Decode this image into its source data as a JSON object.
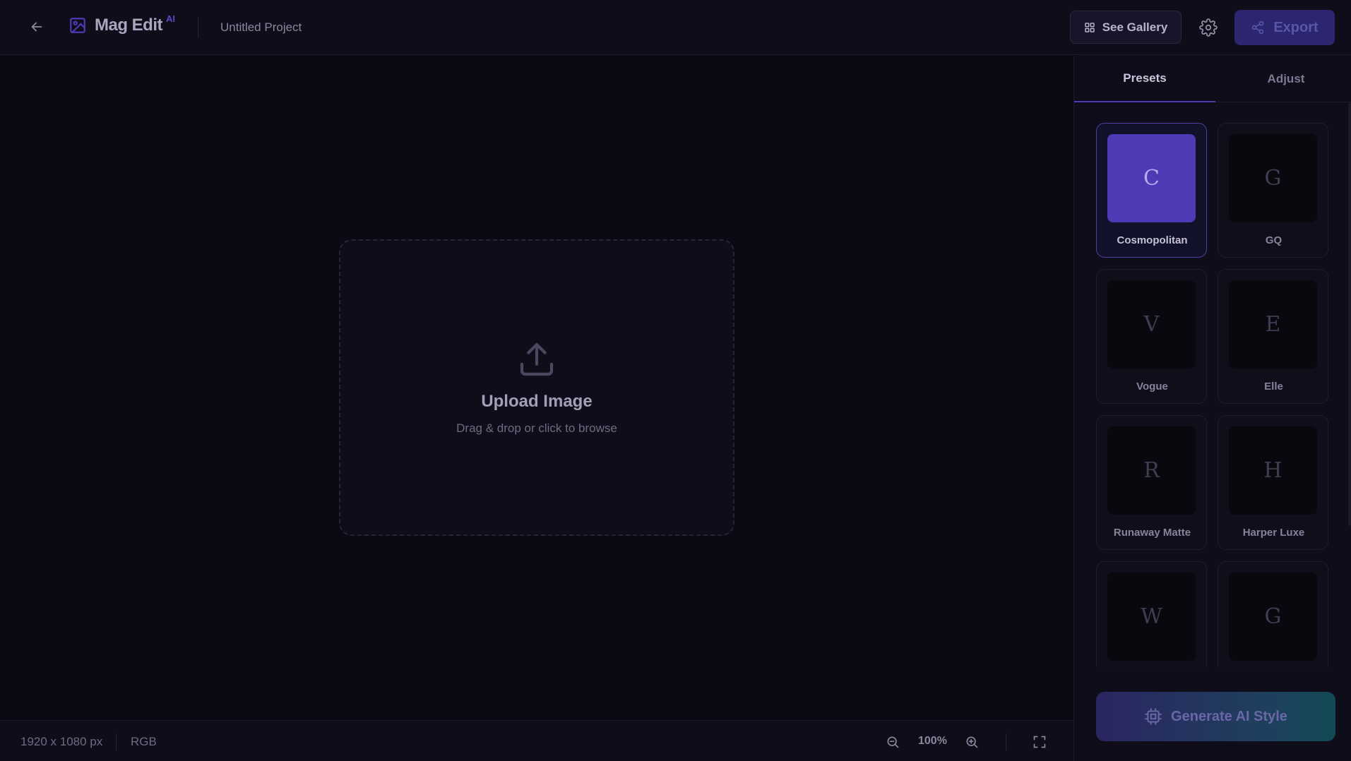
{
  "header": {
    "app_name": "Mag Edit",
    "app_badge": "AI",
    "project_title": "Untitled Project",
    "gallery_label": "See Gallery",
    "export_label": "Export"
  },
  "upload": {
    "title": "Upload Image",
    "subtitle": "Drag & drop or click to browse"
  },
  "status": {
    "dimensions": "1920 x 1080 px",
    "color_mode": "RGB",
    "zoom": "100%"
  },
  "panel": {
    "tabs": [
      {
        "label": "Presets",
        "active": true
      },
      {
        "label": "Adjust",
        "active": false
      }
    ],
    "presets": [
      {
        "letter": "C",
        "name": "Cosmopolitan",
        "selected": true
      },
      {
        "letter": "G",
        "name": "GQ",
        "selected": false
      },
      {
        "letter": "V",
        "name": "Vogue",
        "selected": false
      },
      {
        "letter": "E",
        "name": "Elle",
        "selected": false
      },
      {
        "letter": "R",
        "name": "Runaway Matte",
        "selected": false
      },
      {
        "letter": "H",
        "name": "Harper Luxe",
        "selected": false
      },
      {
        "letter": "W",
        "name": "",
        "selected": false
      },
      {
        "letter": "G",
        "name": "",
        "selected": false
      }
    ],
    "generate_label": "Generate AI Style"
  },
  "colors": {
    "accent": "#4e3ab4",
    "background": "#0b0a14",
    "panel": "#0e0d19"
  },
  "icons": [
    "arrow-left-icon",
    "image-icon",
    "grid-icon",
    "gear-icon",
    "share-icon",
    "upload-icon",
    "zoom-out-icon",
    "zoom-in-icon",
    "fullscreen-icon",
    "chip-icon"
  ]
}
